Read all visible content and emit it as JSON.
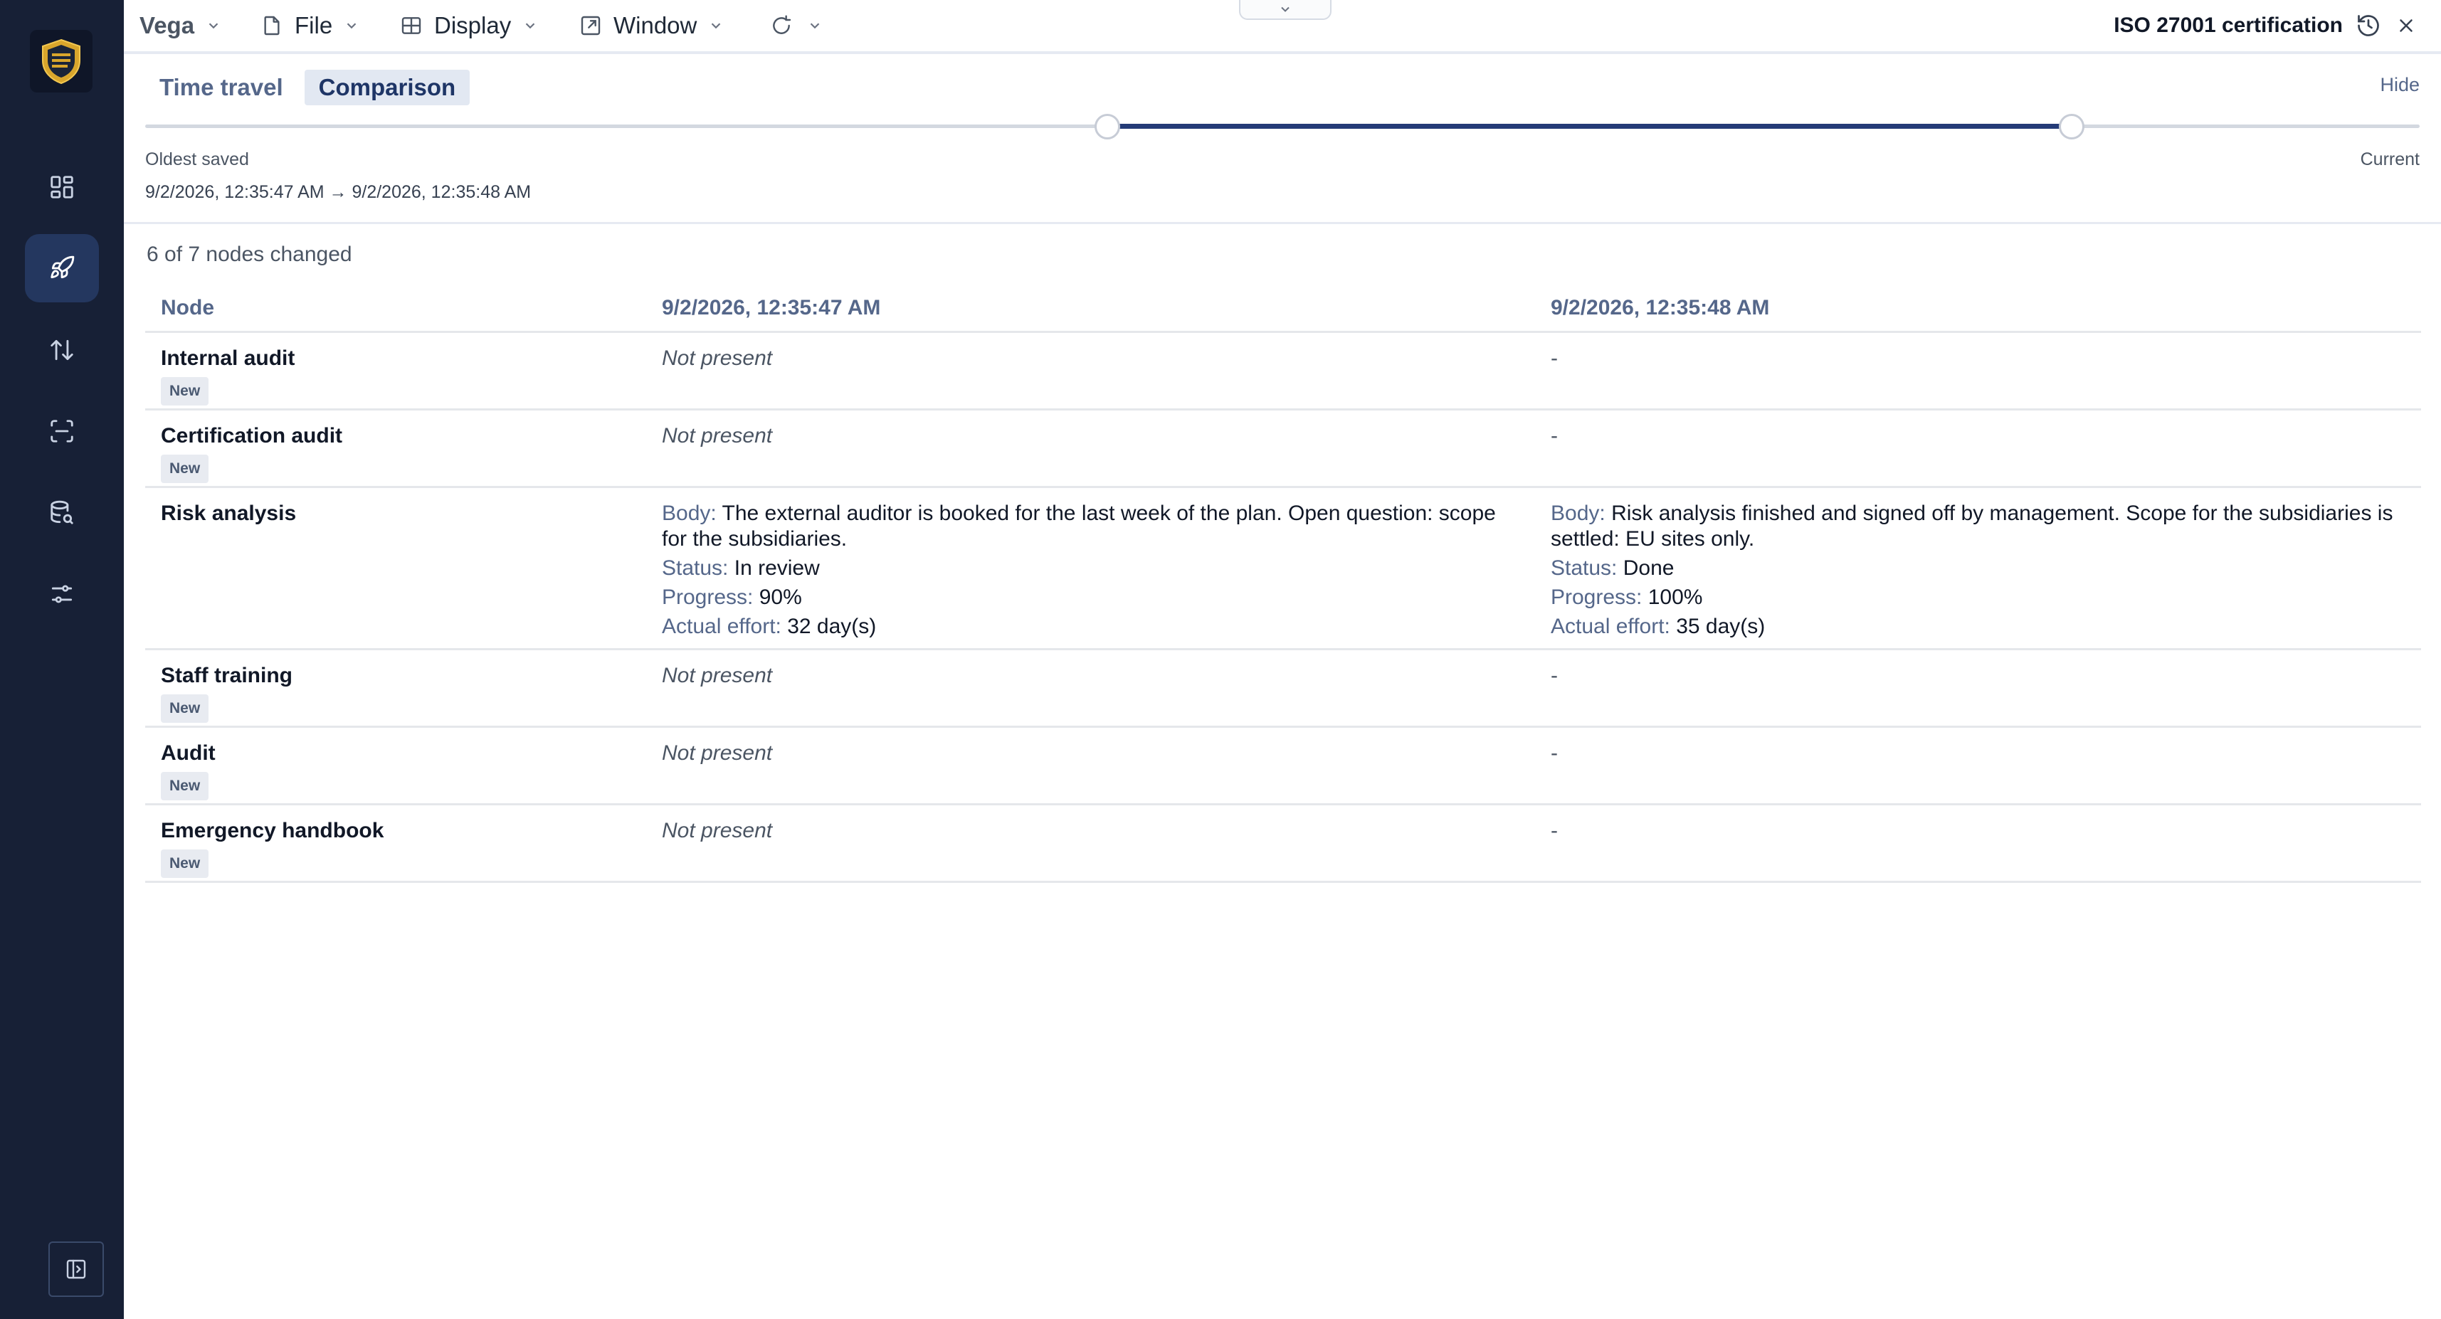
{
  "topbar": {
    "brand": "Vega",
    "menus": [
      {
        "label": "File",
        "icon": "file-icon"
      },
      {
        "label": "Display",
        "icon": "grid-icon"
      },
      {
        "label": "Window",
        "icon": "external-window-icon"
      }
    ],
    "document_title": "ISO 27001 certification"
  },
  "sidebar": {
    "items": [
      {
        "name": "dashboard-icon"
      },
      {
        "name": "rocket-icon",
        "active": true
      },
      {
        "name": "sort-arrows-icon"
      },
      {
        "name": "scan-icon"
      },
      {
        "name": "database-search-icon"
      },
      {
        "name": "sliders-icon"
      }
    ]
  },
  "timetravel": {
    "tab_time_travel": "Time travel",
    "tab_comparison": "Comparison",
    "hide": "Hide",
    "oldest_label": "Oldest saved",
    "current_label": "Current",
    "range_text": "9/2/2026, 12:35:47 AM → 9/2/2026, 12:35:48 AM",
    "range_start_fraction": 0.423,
    "range_end_fraction": 0.847
  },
  "comparison": {
    "summary": "6 of 7 nodes changed",
    "headers": {
      "node": "Node",
      "left": "9/2/2026, 12:35:47 AM",
      "right": "9/2/2026, 12:35:48 AM"
    },
    "rows": [
      {
        "node": "Internal audit",
        "badge": "New",
        "left": "Not present",
        "right": "-"
      },
      {
        "node": "Certification audit",
        "badge": "New",
        "left": "Not present",
        "right": "-"
      },
      {
        "node": "Risk analysis",
        "left_fields": {
          "body_key": "Body:",
          "body": "The external auditor is booked for the last week of the plan. Open question: scope for the subsidiaries.",
          "status_key": "Status:",
          "status": "In review",
          "progress_key": "Progress:",
          "progress": "90%",
          "effort_key": "Actual effort:",
          "effort": "32 day(s)"
        },
        "right_fields": {
          "body_key": "Body:",
          "body": "Risk analysis finished and signed off by management. Scope for the subsidiaries is settled: EU sites only.",
          "status_key": "Status:",
          "status": "Done",
          "progress_key": "Progress:",
          "progress": "100%",
          "effort_key": "Actual effort:",
          "effort": "35 day(s)"
        }
      },
      {
        "node": "Staff training",
        "badge": "New",
        "left": "Not present",
        "right": "-"
      },
      {
        "node": "Audit",
        "badge": "New",
        "left": "Not present",
        "right": "-"
      },
      {
        "node": "Emergency handbook",
        "badge": "New",
        "left": "Not present",
        "right": "-"
      }
    ]
  },
  "colors": {
    "sidebar_bg": "#172036",
    "accent": "#243b77",
    "logo_gold": "#d9a62c"
  }
}
